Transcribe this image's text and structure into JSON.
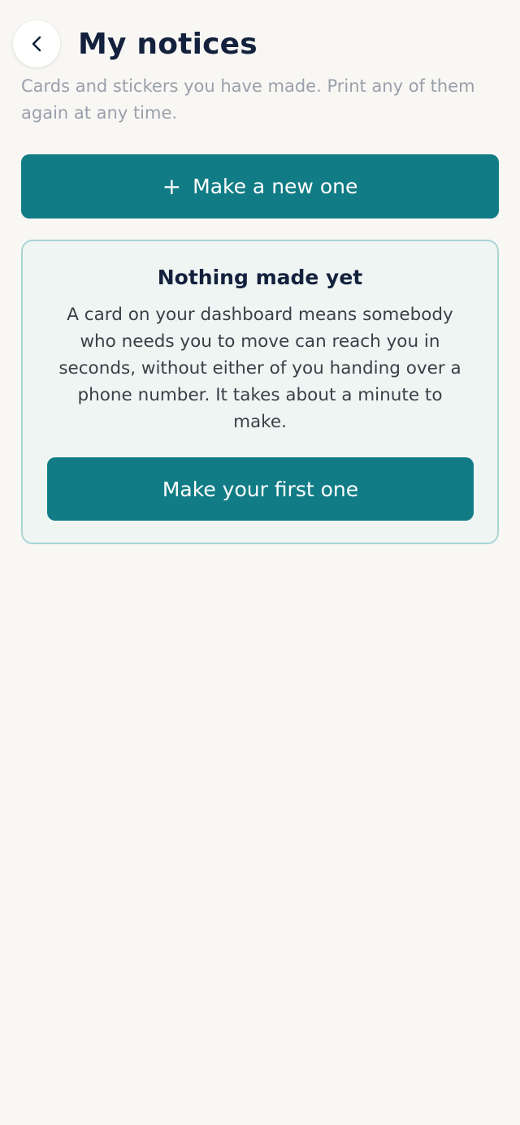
{
  "header": {
    "title": "My notices",
    "back_icon": "chevron-left-icon"
  },
  "subtitle": "Cards and stickers you have made. Print any of them again at any time.",
  "new_button": {
    "icon": "+",
    "label": "Make a new one"
  },
  "empty_state": {
    "title": "Nothing made yet",
    "body": "A card on your dashboard means somebody who needs you to move can reach you in seconds, without either of you handing over a phone number. It takes about a minute to make.",
    "button_label": "Make your first one"
  },
  "colors": {
    "accent": "#117c85",
    "title": "#14213d",
    "background": "#f8f7f4",
    "card_background": "#eff5f3",
    "card_border": "#a9d4d3"
  }
}
